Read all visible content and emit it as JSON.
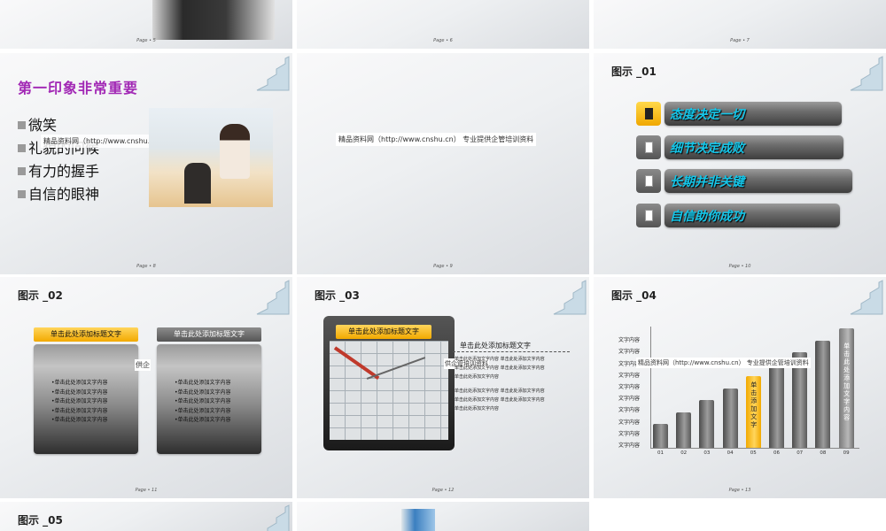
{
  "slides": {
    "s5": {
      "page": "Page • 5"
    },
    "s6": {
      "page": "Page • 6"
    },
    "s7": {
      "page": "Page • 7"
    },
    "s8": {
      "title": "第一印象非常重要",
      "bullets": [
        "微笑",
        "礼貌的问候",
        "有力的握手",
        "自信的眼神"
      ],
      "watermark": "精品资料网（http://www.cnshu.cn） 专业提供",
      "page": "Page • 8"
    },
    "s9": {
      "watermark": "精品资料网（http://www.cnshu.cn） 专业提供企管培训资料",
      "page": "Page • 9"
    },
    "s10": {
      "title": "图示 _01",
      "items": [
        "态度决定一切",
        "细节决定成败",
        "长期并非关键",
        "自信助你成功"
      ],
      "page": "Page • 10"
    },
    "s11": {
      "title": "图示 _02",
      "left_header": "单击此处添加标题文字",
      "right_header": "单击此处添加标题文字",
      "items": [
        "•单击此处添加文字内容",
        "•单击此处添加文字内容",
        "•单击此处添加文字内容",
        "•单击此处添加文字内容",
        "•单击此处添加文字内容"
      ],
      "watermark": "供企",
      "page": "Page • 11"
    },
    "s12": {
      "title": "图示 _03",
      "frame_header": "单击此处添加标题文字",
      "right_title": "单击此处添加标题文字",
      "row": "单击此处添加文字内容   单击此处添加文字内容",
      "row_single": "单击此处添加文字内容",
      "watermark": "供企管培训资料",
      "page": "Page • 12"
    },
    "s13": {
      "title": "图示 _04",
      "y_label": "文字内容",
      "watermark": "精品资料网（http://www.cnshu.cn） 专业提供企管培训资料",
      "highlight_text": "单击添加文字",
      "tall_text": "单击此处添加文字内容",
      "page": "Page • 13"
    },
    "s14": {
      "title": "图示 _05"
    }
  },
  "chart_data": {
    "type": "bar",
    "categories": [
      "01",
      "02",
      "03",
      "04",
      "05",
      "06",
      "07",
      "08",
      "09"
    ],
    "values": [
      2,
      3,
      4,
      5,
      6,
      7,
      8,
      9,
      10
    ],
    "highlight_index": 4,
    "ylim": [
      0,
      10
    ],
    "y_tick_labels": [
      "文字内容",
      "文字内容",
      "文字内容",
      "文字内容",
      "文字内容",
      "文字内容",
      "文字内容",
      "文字内容",
      "文字内容",
      "文字内容"
    ]
  },
  "colors": {
    "accent": "#f2a900",
    "title_purple": "#a229b5",
    "cyan_text": "#14c5e8"
  }
}
